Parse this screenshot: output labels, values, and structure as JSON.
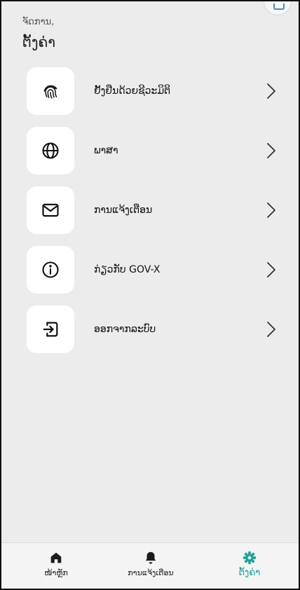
{
  "header": {
    "subtitle": "ຈັດການ,",
    "title": "ຕັ້ງຄ່າ"
  },
  "menu": {
    "items": [
      {
        "label": "ຢັ້ງຢືນດ້ວຍຊີວະມິຕິ",
        "icon": "fingerprint-icon"
      },
      {
        "label": "ພາສາ",
        "icon": "globe-icon"
      },
      {
        "label": "ການແຈ້ງເຕືອນ",
        "icon": "mail-icon"
      },
      {
        "label": "ກ່ຽວກັບ GOV-X",
        "icon": "info-icon"
      },
      {
        "label": "ອອກຈາກລະບົບ",
        "icon": "logout-icon"
      }
    ]
  },
  "bottom_nav": {
    "items": [
      {
        "label": "ໜ້າຫຼັກ",
        "icon": "home-icon",
        "active": false
      },
      {
        "label": "ການແຈ້ງເຕືອນ",
        "icon": "bell-icon",
        "active": false
      },
      {
        "label": "ຕັ້ງຄ່າ",
        "icon": "gear-icon",
        "active": true
      }
    ]
  },
  "colors": {
    "accent": "#1aa79a",
    "background": "#ececec",
    "card": "#ffffff"
  }
}
